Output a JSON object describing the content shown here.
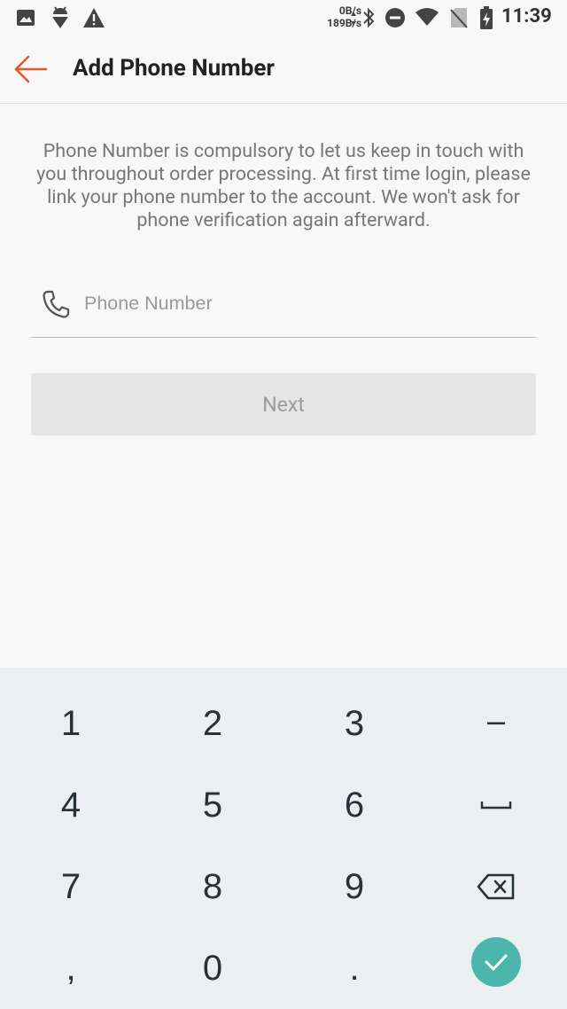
{
  "status_bar": {
    "upload_speed": "0B/s",
    "download_speed": "189B/s",
    "time": "11:39",
    "icons": [
      "image-icon",
      "android-debug-icon",
      "warning-icon",
      "bluetooth-icon",
      "do-not-disturb-icon",
      "wifi-icon",
      "no-sim-icon",
      "battery-charging-icon"
    ]
  },
  "app_bar": {
    "title": "Add Phone Number",
    "back_icon": "arrow-left-icon",
    "accent_color": "#e05a2b"
  },
  "main": {
    "intro_text": "Phone Number is compulsory to let us keep in touch with you throughout order processing. At first time login, please link your phone number to the account. We won't ask for phone verification again afterward.",
    "phone_field": {
      "placeholder": "Phone Number",
      "value": "",
      "icon": "phone-icon"
    },
    "next_label": "Next"
  },
  "keyboard": {
    "keys": [
      "1",
      "2",
      "3",
      "-",
      "4",
      "5",
      "6",
      "space",
      "7",
      "8",
      "9",
      "backspace",
      ",",
      "0",
      ".",
      "done"
    ],
    "done_color": "#4db6ac"
  }
}
